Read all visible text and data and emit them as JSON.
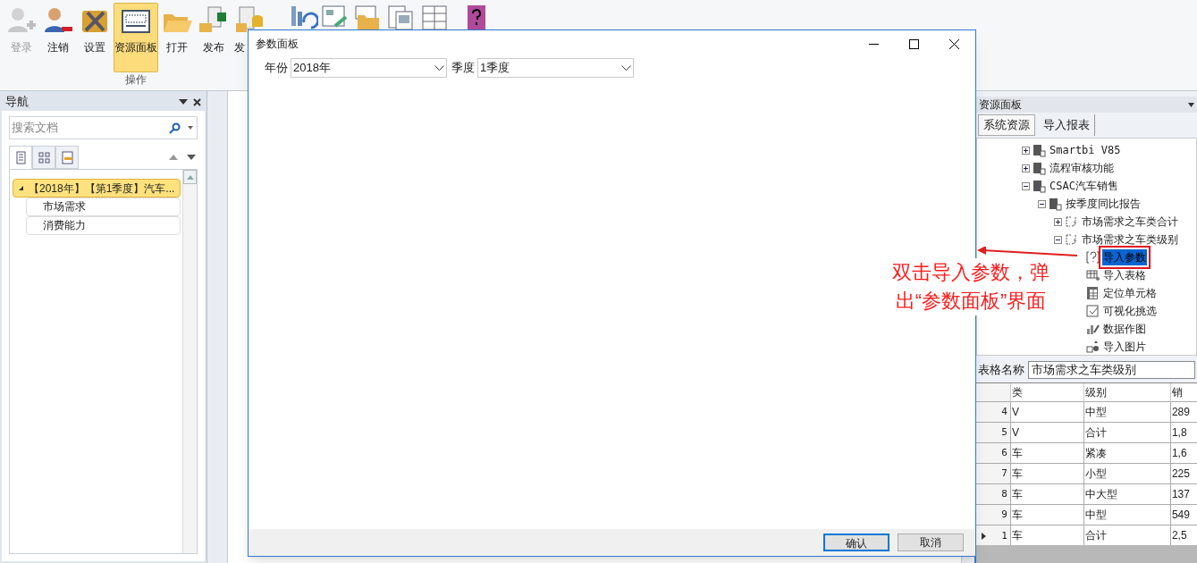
{
  "ribbon": {
    "buttons": [
      {
        "label": "登录",
        "kind": "login",
        "disabled": true,
        "selected": false
      },
      {
        "label": "注销",
        "kind": "logout",
        "disabled": false,
        "selected": false
      },
      {
        "label": "设置",
        "kind": "settings",
        "disabled": false,
        "selected": false
      },
      {
        "label": "资源面板",
        "kind": "panel",
        "disabled": false,
        "selected": true
      },
      {
        "label": "打开",
        "kind": "open",
        "disabled": false,
        "selected": false
      },
      {
        "label": "发布",
        "kind": "publish",
        "disabled": false,
        "selected": false
      },
      {
        "label": "发",
        "kind": "database",
        "disabled": false,
        "selected": false
      }
    ],
    "group_label": "操作"
  },
  "nav_panel": {
    "title": "导航",
    "search": {
      "placeholder": "搜索文档"
    },
    "tabs": [
      {
        "kind": "page",
        "selected": true
      },
      {
        "kind": "grid",
        "selected": false
      },
      {
        "kind": "list",
        "selected": false
      }
    ],
    "outline": [
      {
        "label": "【2018年】【第1季度】汽车...",
        "selected": true,
        "expanded": true,
        "children": [
          {
            "label": "市场需求",
            "selected": false
          },
          {
            "label": "消费能力",
            "selected": false
          }
        ]
      }
    ]
  },
  "dialog": {
    "title": "参数面板",
    "fields": [
      {
        "label": "年份",
        "value": "2018年"
      },
      {
        "label": "季度",
        "value": "1季度"
      }
    ],
    "buttons": [
      {
        "label": "确认",
        "default": true
      },
      {
        "label": "取消",
        "default": false
      }
    ]
  },
  "resource_panel": {
    "title": "资源面板",
    "tabs": [
      {
        "label": "系统资源",
        "selected": true
      },
      {
        "label": "导入报表",
        "selected": false
      }
    ],
    "tree": [
      {
        "label": "Smartbi V85",
        "kind": "folder",
        "expanded": false,
        "selected": false
      },
      {
        "label": "流程审核功能",
        "kind": "folder",
        "expanded": false,
        "selected": false
      },
      {
        "label": "CSAC汽车销售",
        "kind": "folder",
        "expanded": true,
        "selected": false,
        "children": [
          {
            "label": "按季度同比报告",
            "kind": "folder",
            "expanded": true,
            "selected": false,
            "children": [
              {
                "label": "市场需求之车类合计",
                "kind": "sheet",
                "expanded": false,
                "selected": false
              },
              {
                "label": "市场需求之车类级别",
                "kind": "sheet",
                "expanded": true,
                "selected": false,
                "children": [
                  {
                    "label": "导入参数",
                    "kind": "param",
                    "selected": true
                  },
                  {
                    "label": "导入表格",
                    "kind": "table",
                    "selected": false
                  },
                  {
                    "label": "定位单元格",
                    "kind": "cell",
                    "selected": false
                  },
                  {
                    "label": "可视化挑选",
                    "kind": "filter",
                    "selected": false
                  },
                  {
                    "label": "数据作图",
                    "kind": "chart",
                    "selected": false
                  },
                  {
                    "label": "导入图片",
                    "kind": "image",
                    "selected": false
                  }
                ]
              }
            ]
          }
        ]
      }
    ],
    "table_name": {
      "label": "表格名称",
      "value": "市场需求之车类级别"
    },
    "table": {
      "columns": [
        "类",
        "级别",
        "销"
      ],
      "rows": [
        {
          "index": "4",
          "current": false,
          "cells": [
            "V",
            "中型",
            "289"
          ]
        },
        {
          "index": "5",
          "current": false,
          "cells": [
            "V",
            "合计",
            "1,8"
          ]
        },
        {
          "index": "6",
          "current": false,
          "cells": [
            "车",
            "紧凑",
            "1,6"
          ]
        },
        {
          "index": "7",
          "current": false,
          "cells": [
            "车",
            "小型",
            "225"
          ]
        },
        {
          "index": "8",
          "current": false,
          "cells": [
            "车",
            "中大型",
            "137"
          ]
        },
        {
          "index": "9",
          "current": false,
          "cells": [
            "车",
            "中型",
            "549"
          ]
        },
        {
          "index": "1",
          "current": true,
          "cells": [
            "车",
            "合计",
            "2,5"
          ]
        }
      ]
    }
  },
  "annotation": {
    "text": "双击导入参数，弹出“参数面板”界面"
  }
}
